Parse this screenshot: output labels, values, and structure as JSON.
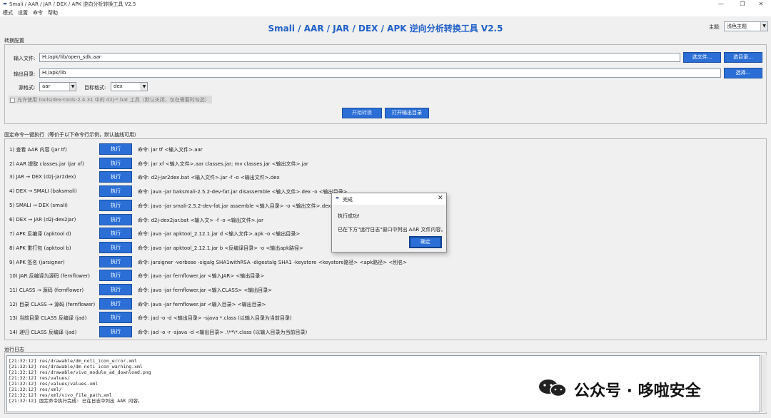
{
  "window": {
    "title": "Smali / AAR / JAR / DEX / APK 逆向分析转换工具 V2.5",
    "min_glyph": "—",
    "restore_glyph": "❐",
    "close_glyph": "✕"
  },
  "menu": {
    "items": [
      "模式",
      "设置",
      "命令",
      "帮助"
    ]
  },
  "header": {
    "title": "Smali / AAR / JAR / DEX / APK 逆向分析转换工具 V2.5",
    "theme_label": "主题:",
    "theme_value": "浅色主题"
  },
  "convert": {
    "section_label": "转换配置",
    "input_label": "输入文件:",
    "input_value": "H:/apk/lib/open_sdk.aar",
    "choose_file_label": "选文件...",
    "choose_dir_label": "选目录...",
    "output_label": "输出目录:",
    "output_value": "H:/apk/lib",
    "output_choose_label": "选择...",
    "source_format_label": "源格式:",
    "source_format_value": "aar",
    "target_format_label": "目标格式:",
    "target_format_value": "dex",
    "checkbox_label": "允许使用 tools/dex-tools-2.4.31 中的 d2j-*.bat 工具（默认关闭，仅在需要时勾选）",
    "start_label": "开始转换",
    "open_output_label": "打开输出目录"
  },
  "commands": {
    "section_label": "固定命令一键执行（等价于以下命令行示例，默认抽线可用）",
    "run_label": "执行",
    "rows": [
      {
        "name": "1) 查看 AAR 内容 (jar tf)",
        "cmd": "命令: jar tf <输入文件>.aar"
      },
      {
        "name": "2) AAR 提取 classes.jar (jar xf)",
        "cmd": "命令: jar xf <输入文件>.aar classes.jar; mv classes.jar <输出文件>.jar"
      },
      {
        "name": "3) JAR → DEX (d2j-jar2dex)",
        "cmd": "命令: d2j-jar2dex.bat <输入文件>.jar -f -o <输出文件>.dex"
      },
      {
        "name": "4) DEX → SMALI (baksmali)",
        "cmd": "命令: java -jar baksmali-2.5.2-dev-fat.jar disassemble <输入文件>.dex -o <输出目录>"
      },
      {
        "name": "5) SMALI → DEX (smali)",
        "cmd": "命令: java -jar smali-2.5.2-dev-fat.jar assemble <输入目录> -o <输出文件>.dex"
      },
      {
        "name": "6) DEX → JAR (d2j-dex2jar)",
        "cmd": "命令: d2j-dex2jar.bat <输入文> -f -o <输出文件>.jar"
      },
      {
        "name": "7) APK 反编译 (apktool d)",
        "cmd": "命令: java -jar apktool_2.12.1.jar d <输入文件>.apk -o <输出目录>"
      },
      {
        "name": "8) APK 重打包 (apktool b)",
        "cmd": "命令: java -jar apktool_2.12.1.jar b <反编译目录> -o <输出apk路径>"
      },
      {
        "name": "9) APK 签名 (jarsigner)",
        "cmd": "命令: jarsigner -verbose -sigalg SHA1withRSA -digestalg SHA1 -keystore <keystore路径> <apk路径> <别名>"
      },
      {
        "name": "10) JAR 反编译为源码 (fernflower)",
        "cmd": "命令: java -jar fernflower.jar <输入JAR> <输出目录>"
      },
      {
        "name": "11) CLASS → 源码 (fernflower)",
        "cmd": "命令: java -jar fernflower.jar <输入CLASS> <输出目录>"
      },
      {
        "name": "12) 目录 CLASS → 源码 (fernflower)",
        "cmd": "命令: java -jar fernflower.jar <输入目录> <输出目录>"
      },
      {
        "name": "13) 当前目录 CLASS 反编译 (jad)",
        "cmd": "命令: jad -o -d <输出目录> -sjava *.class (以输入目录为当前目录)"
      },
      {
        "name": "14) 递归 CLASS 反编译 (jad)",
        "cmd": "命令: jad -o -r -sjava -d <输出目录> .\\**\\*.class (以输入目录为当前目录)"
      }
    ]
  },
  "log": {
    "section_label": "运行日志",
    "lines": [
      "[21:32:12] res/drawable/dm_noti_icon_error.xml",
      "[21:32:12] res/drawable/dm_noti_icon_warning.xml",
      "[21:32:12] res/drawable/vivo_module_ad_download.png",
      "[21:32:12] res/values/",
      "[21:32:12] res/values/values.xml",
      "[21:32:12] res/xml/",
      "[21:32:12] res/xml/vivo_file_path.xml",
      "[21:32:12] 固定命令执行完成: 已在日志中列出 AAR 内容。"
    ]
  },
  "dialog": {
    "title": "完成",
    "line1": "执行成功!",
    "line2": "已在下方\"运行日志\"窗口中列出 AAR 文件内容。",
    "ok_label": "确定"
  },
  "watermark": {
    "text": "公众号 · 哆啦安全"
  }
}
